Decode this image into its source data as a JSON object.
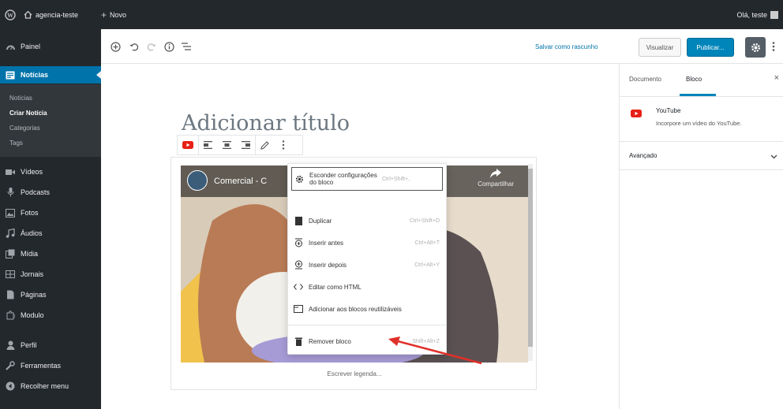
{
  "adminbar": {
    "site_name": "agencia-teste",
    "new_label": "Novo",
    "greeting": "Olá, teste"
  },
  "sidebar": {
    "items": [
      {
        "label": "Painel",
        "icon": "dashboard-icon"
      },
      {
        "label": "Notícias",
        "icon": "news-icon"
      },
      {
        "label": "Vídeos",
        "icon": "video-icon"
      },
      {
        "label": "Podcasts",
        "icon": "microphone-icon"
      },
      {
        "label": "Fotos",
        "icon": "photo-icon"
      },
      {
        "label": "Áudios",
        "icon": "audio-icon"
      },
      {
        "label": "Mídia",
        "icon": "media-icon"
      },
      {
        "label": "Jornais",
        "icon": "newspaper-icon"
      },
      {
        "label": "Páginas",
        "icon": "pages-icon"
      },
      {
        "label": "Modulo",
        "icon": "puzzle-icon"
      },
      {
        "label": "Perfil",
        "icon": "user-icon"
      },
      {
        "label": "Ferramentas",
        "icon": "tools-icon"
      },
      {
        "label": "Recolher menu",
        "icon": "collapse-icon"
      }
    ],
    "submenu": [
      "Notícias",
      "Criar Notícia",
      "Categorias",
      "Tags"
    ]
  },
  "toolbar": {
    "save_draft": "Salvar como rascunho",
    "preview": "Visualizar",
    "publish": "Publicar..."
  },
  "editor": {
    "title_placeholder": "Adicionar título",
    "video_title": "Comercial - C",
    "share_label": "Compartilhar",
    "caption_placeholder": "Escrever legenda..."
  },
  "context_menu": {
    "items": [
      {
        "label": "Esconder configurações do bloco",
        "shortcut": "Ctrl+Shift+,",
        "icon": "gear-icon"
      },
      {
        "label": "Duplicar",
        "shortcut": "Ctrl+Shift+D",
        "icon": "duplicate-icon"
      },
      {
        "label": "Inserir antes",
        "shortcut": "Ctrl+Alt+T",
        "icon": "insert-before-icon"
      },
      {
        "label": "Inserir depois",
        "shortcut": "Ctrl+Alt+Y",
        "icon": "insert-after-icon"
      },
      {
        "label": "Editar como HTML",
        "shortcut": "",
        "icon": "html-icon"
      },
      {
        "label": "Adicionar aos blocos reutilizáveis",
        "shortcut": "",
        "icon": "reusable-block-icon"
      },
      {
        "label": "Remover bloco",
        "shortcut": "Shift+Alt+Z",
        "icon": "trash-icon"
      }
    ]
  },
  "settings": {
    "tab_document": "Documento",
    "tab_block": "Bloco",
    "block_name": "YouTube",
    "block_description": "Incorpore um vídeo do YouTube.",
    "advanced": "Avançado"
  },
  "colors": {
    "adminbar_bg": "#23282d",
    "accent": "#0085ba",
    "youtube_red": "#e62117",
    "annotation_arrow": "#e0302a"
  }
}
